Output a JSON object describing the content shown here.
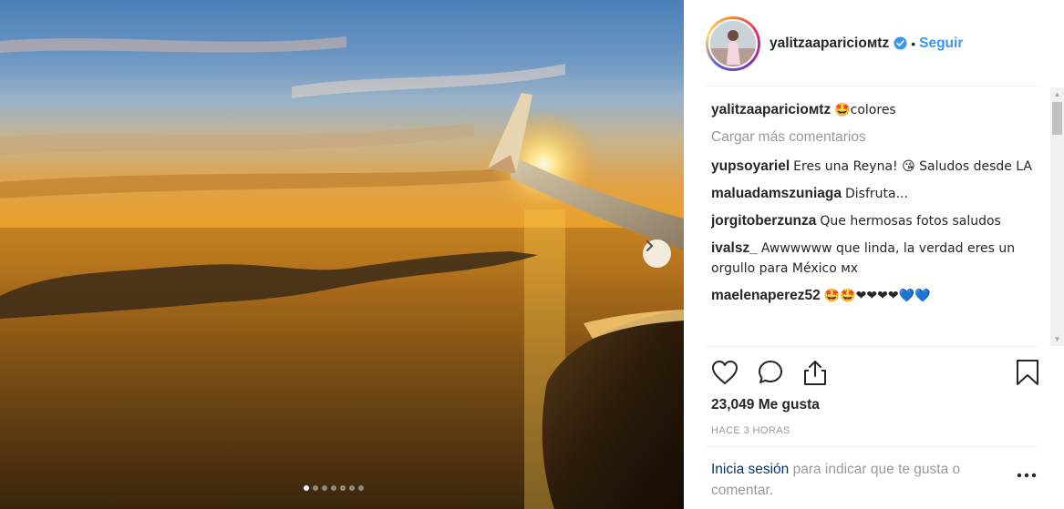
{
  "post": {
    "username": "yalitzaaparicioмtz",
    "follow_label": "Seguir",
    "separator": "•",
    "caption_user": "yalitzaaparicioмtz",
    "caption_text": "🤩colores",
    "load_more": "Cargar más comentarios",
    "likes": "23,049 Me gusta",
    "time": "HACE 3 HORAS",
    "login_link": "Inicia sesión",
    "login_rest": " para indicar que te gusta o comentar."
  },
  "comments": [
    {
      "user": "yupsoyariel",
      "text": "Eres una Reyna! 😘 Saludos desde LA"
    },
    {
      "user": "maluadamszuniaga",
      "text": "Disfruta..."
    },
    {
      "user": "jorgitoberzunza",
      "text": "Que hermosas fotos saludos"
    },
    {
      "user": "ivalsz_",
      "text": "Awwwwww que linda, la verdad eres un orgullo para México мх"
    },
    {
      "user": "maelenaperez52",
      "text": "🤩🤩❤❤❤❤💙💙"
    }
  ],
  "carousel": {
    "total": 7,
    "active": 0
  },
  "icons": {
    "verified": "verified-badge-icon",
    "like": "heart-icon",
    "comment": "comment-bubble-icon",
    "share": "share-icon",
    "save": "bookmark-icon",
    "next": "chevron-right-icon",
    "more": "ellipsis-icon"
  },
  "colors": {
    "accent": "#3897f0",
    "link": "#003569",
    "muted": "#999999",
    "text": "#262626"
  }
}
